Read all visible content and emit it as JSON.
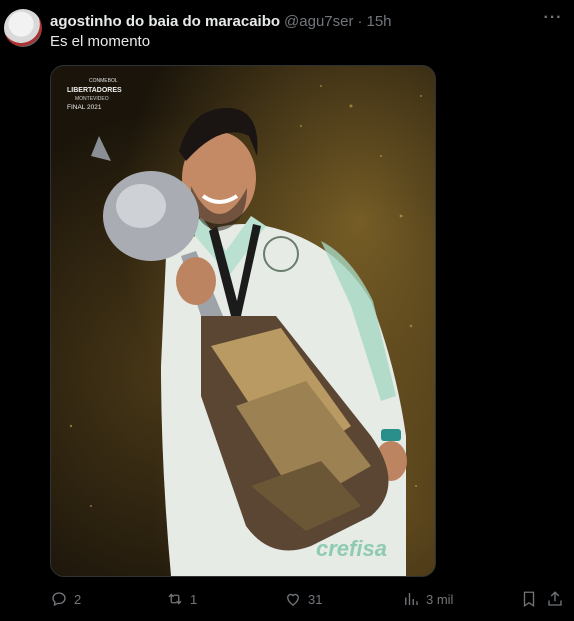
{
  "tweet": {
    "author_name": "agostinho do baia do maracaibo",
    "handle": "@agu7ser",
    "separator": "·",
    "time": "15h",
    "text": "Es el momento"
  },
  "media": {
    "overlay_logo_line1": "CONMEBOL",
    "overlay_logo_line2": "LIBERTADORES",
    "overlay_logo_line3": "MONTEVIDEO",
    "overlay_logo_line4": "FINAL 2021",
    "shirt_sponsor": "crefisa"
  },
  "actions": {
    "replies": "2",
    "reposts": "1",
    "likes": "31",
    "views": "3 mil"
  },
  "icons": {
    "more": "more-horizontal-icon",
    "reply": "reply-icon",
    "repost": "repost-icon",
    "like": "heart-icon",
    "views": "views-icon",
    "bookmark": "bookmark-icon",
    "share": "share-icon"
  },
  "colors": {
    "background": "#000000",
    "text_primary": "#e7e9ea",
    "text_secondary": "#71767b"
  }
}
